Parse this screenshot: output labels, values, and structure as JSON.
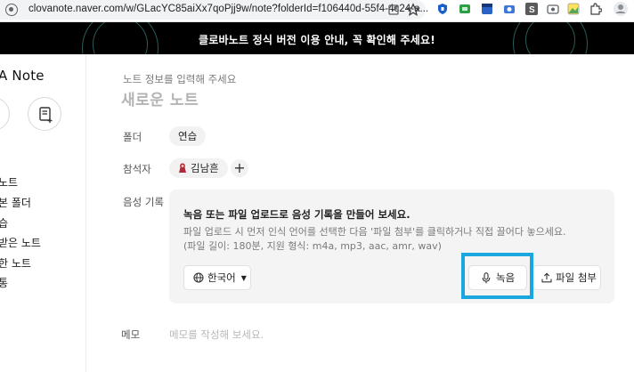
{
  "browser": {
    "url": "clovanote.naver.com/w/GLacYC85aiXx7qoPjj9w/note?folderId=f106440d-55f4-4c24-a..."
  },
  "banner": {
    "text": "클로바노트 정식 버전 이용 안내, 꼭 확인해 주세요!"
  },
  "sidebar": {
    "logo": "A Note",
    "nav_items": [
      {
        "label": "노트"
      },
      {
        "label": "본 폴더"
      },
      {
        "label": "습"
      },
      {
        "label": "받은 노트"
      },
      {
        "label": "한 노트"
      },
      {
        "label": "통"
      }
    ]
  },
  "note": {
    "hint": "노트 정보를 입력해 주세요",
    "title_placeholder": "새로운 노트",
    "folder_label": "폴더",
    "folder_value": "연습",
    "attendees_label": "참석자",
    "attendee_name": "김남흔",
    "voice_label": "음성 기록",
    "memo_label": "메모",
    "memo_placeholder": "메모를 작성해 보세요."
  },
  "recorder": {
    "heading": "녹음 또는 파일 업로드로 음성 기록을 만들어 보세요.",
    "desc_line1": "파일 업로드 시 먼저 인식 언어를 선택한 다음 '파일 첨부'를 클릭하거나 직접 끌어다 놓으세요.",
    "desc_line2": "(파일 길이: 180분, 지원 형식: m4a, mp3, aac, amr, wav)",
    "language": "한국어",
    "record_label": "녹음",
    "attach_label": "파일 첨부"
  },
  "colors": {
    "banner_bg": "#000000",
    "highlight": "#1aa7df"
  }
}
